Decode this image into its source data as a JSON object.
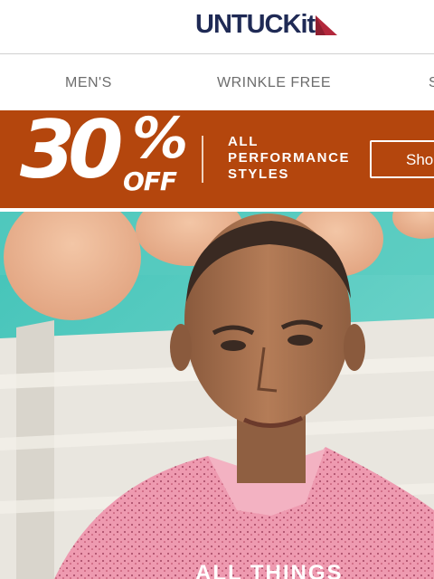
{
  "brand": {
    "logo_text": "UNTUCKit",
    "logo_upper": "UNTUCK",
    "logo_lower": "it",
    "colors": {
      "navy": "#1f2a55",
      "red": "#b3283c"
    }
  },
  "nav": {
    "items": [
      {
        "label": "MEN'S"
      },
      {
        "label": "WRINKLE FREE"
      },
      {
        "label": "S"
      }
    ]
  },
  "promo": {
    "discount": "30",
    "percent_sign": "%",
    "off": "OFF",
    "lines": [
      "ALL",
      "PERFORMANCE",
      "STYLES"
    ],
    "button_label": "Shop",
    "background": "#b4460d"
  },
  "hero": {
    "headline": "ALL THINGS",
    "image": "man-in-pink-shirt-poolside"
  }
}
